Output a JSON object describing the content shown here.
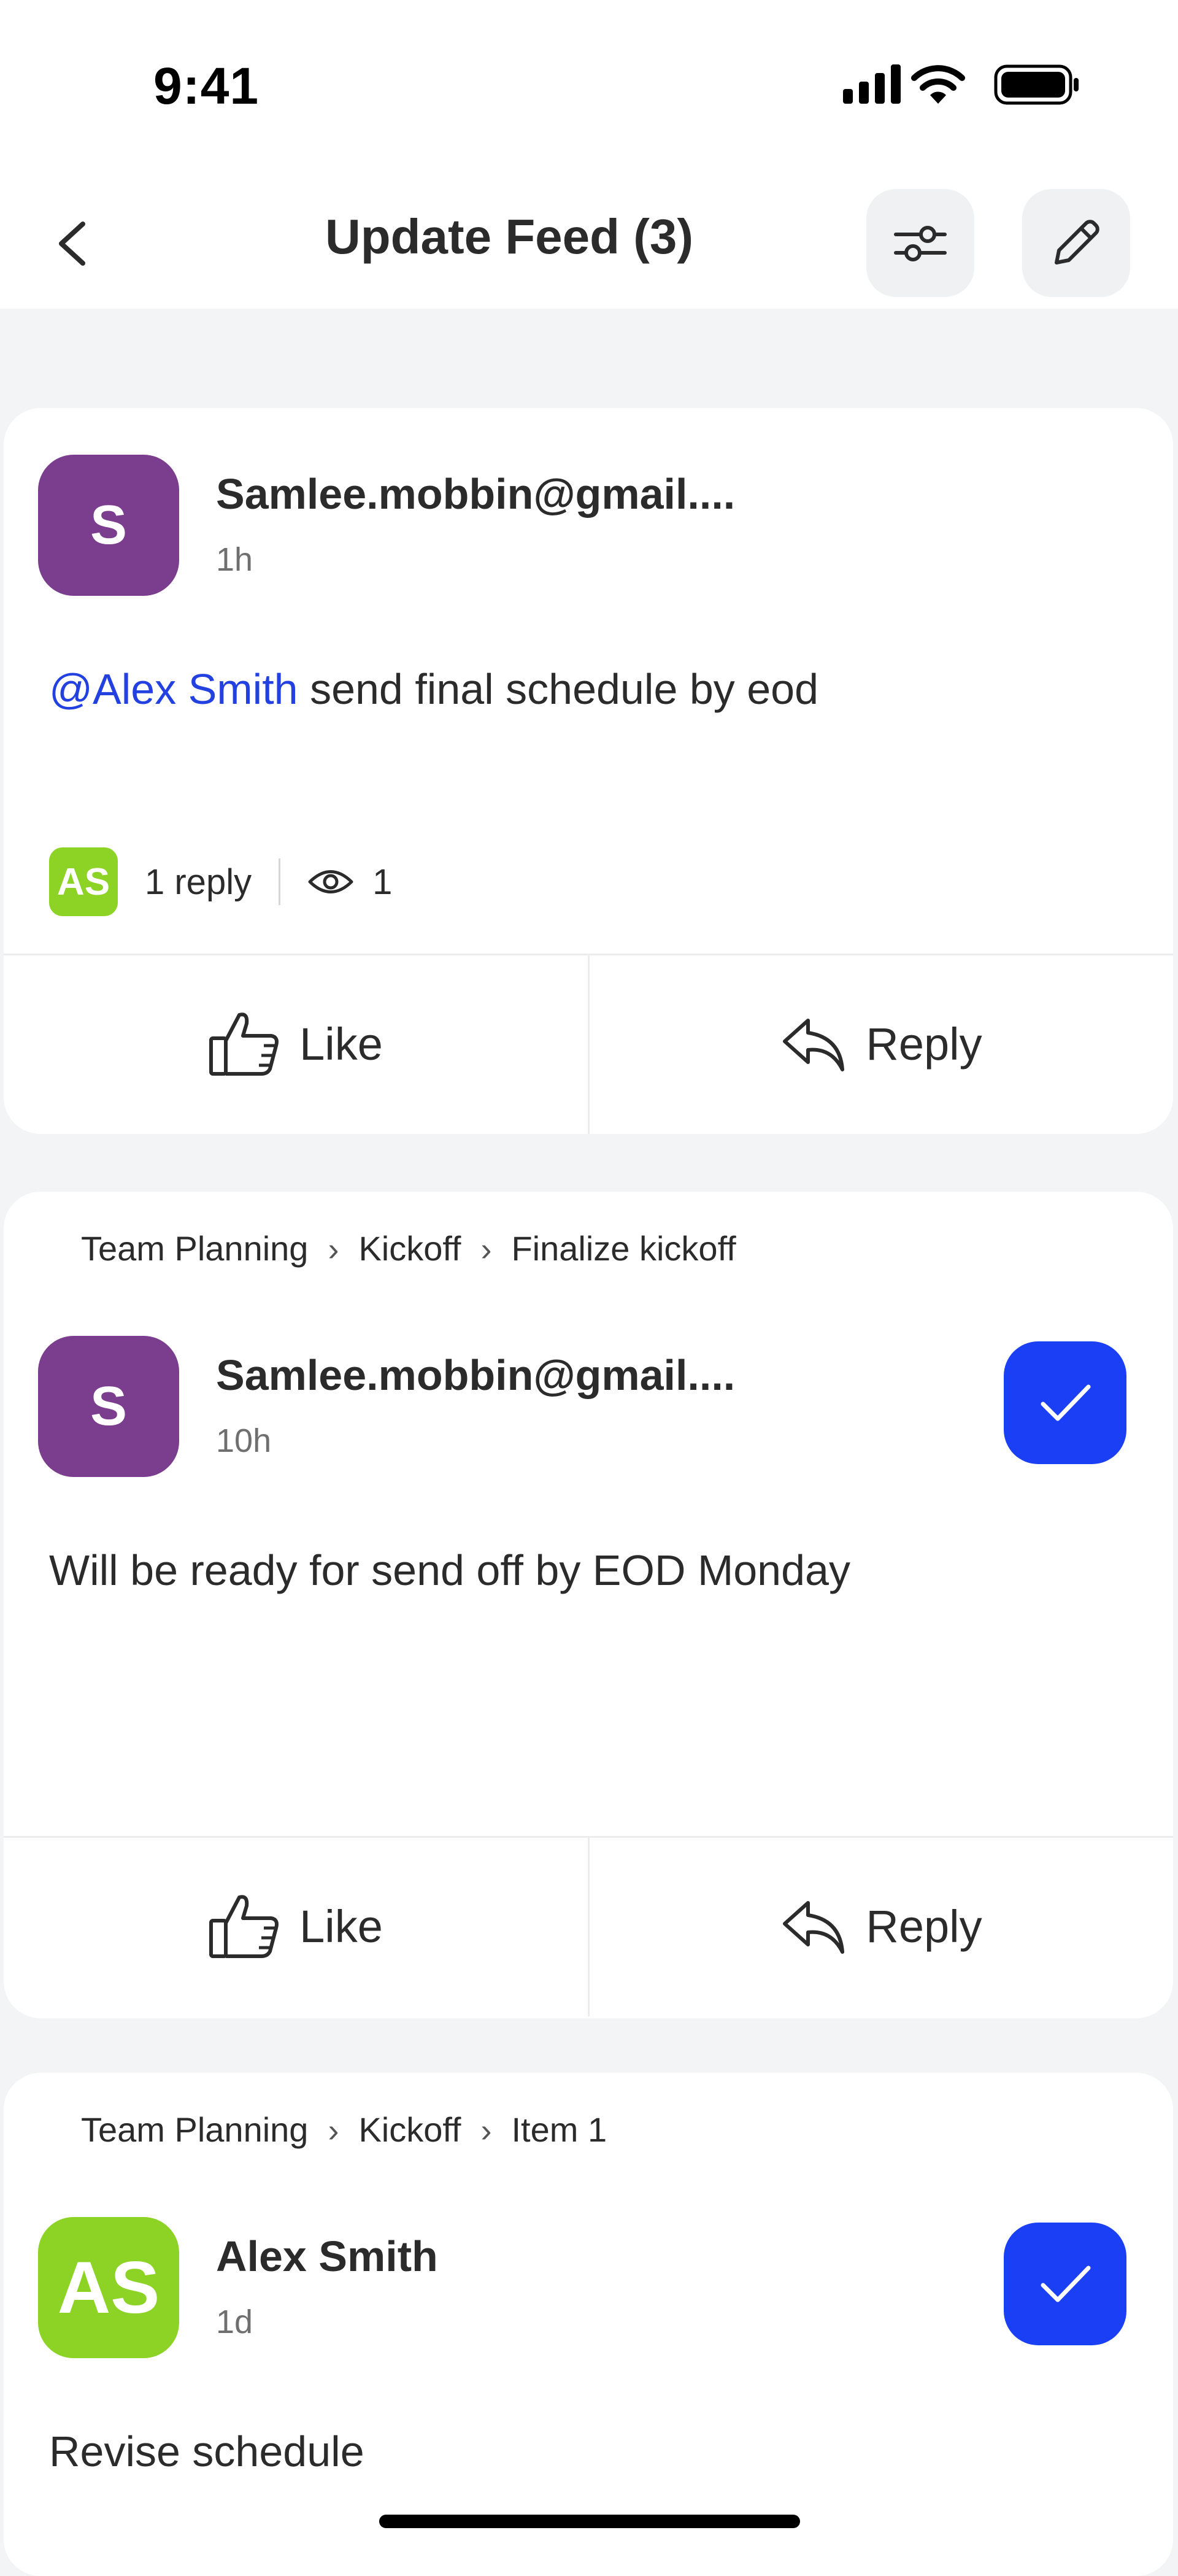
{
  "status_bar": {
    "time": "9:41"
  },
  "header": {
    "title": "Update Feed (3)"
  },
  "icons": {
    "back": "chevron-left-icon",
    "filter": "sliders-icon",
    "compose": "pencil-icon",
    "like": "thumbs-up-icon",
    "reply": "reply-icon",
    "views": "eye-icon",
    "check": "check-icon"
  },
  "colors": {
    "accent_blue": "#1a3ff5",
    "mention_blue": "#2341e0",
    "avatar_purple": "#7b3d8e",
    "avatar_green": "#8cd326"
  },
  "posts": [
    {
      "avatar_initials": "S",
      "author": "Samlee.mobbin@gmail....",
      "time": "1h",
      "mention": "@Alex Smith",
      "text": " send final schedule by eod",
      "reply_avatar": "AS",
      "replies": "1 reply",
      "views": "1",
      "like_label": "Like",
      "reply_label": "Reply"
    },
    {
      "breadcrumb": [
        "Team Planning",
        "Kickoff",
        "Finalize kickoff"
      ],
      "avatar_initials": "S",
      "author": "Samlee.mobbin@gmail....",
      "time": "10h",
      "text": "Will be ready for send off by EOD Monday",
      "like_label": "Like",
      "reply_label": "Reply"
    },
    {
      "breadcrumb": [
        "Team Planning",
        "Kickoff",
        "Item 1"
      ],
      "avatar_initials": "AS",
      "author": "Alex Smith",
      "time": "1d",
      "text": "Revise schedule"
    }
  ]
}
